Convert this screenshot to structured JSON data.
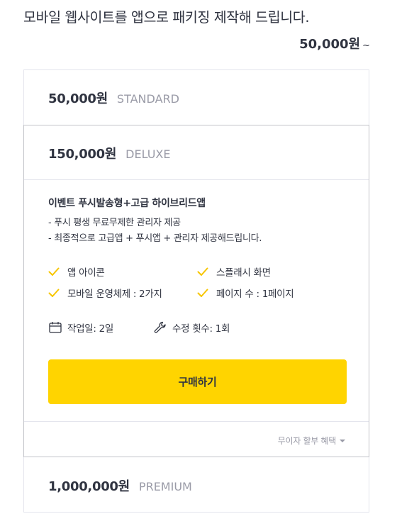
{
  "service": {
    "title": "모바일 웹사이트를 앱으로 패키징 제작해 드립니다.",
    "price_range": "50,000원",
    "price_range_suffix": "~"
  },
  "packages": {
    "standard": {
      "price": "50,000원",
      "tier": "STANDARD"
    },
    "deluxe": {
      "price": "150,000원",
      "tier": "DELUXE",
      "description": {
        "title": "이벤트 푸시발송형+고급 하이브리드앱",
        "lines": [
          "- 푸시 평생 무료무제한 관리자 제공",
          "- 최종적으로 고급앱 + 푸시앱 + 관리자 제공해드립니다."
        ]
      },
      "features": [
        {
          "label": "앱 아이콘",
          "icon": "check-icon"
        },
        {
          "label": "스플래시 화면",
          "icon": "check-icon"
        },
        {
          "label": "모바일 운영체제 : 2가지",
          "icon": "check-icon"
        },
        {
          "label": "페이지 수 : 1페이지",
          "icon": "check-icon"
        }
      ],
      "work_days": "작업일: 2일",
      "revisions": "수정 횟수: 1회",
      "buy_label": "구매하기",
      "installment_label": "무이자 할부 혜택"
    },
    "premium": {
      "price": "1,000,000원",
      "tier": "PREMIUM"
    }
  },
  "colors": {
    "accent_yellow": "#ffd400",
    "check_yellow": "#f7c600",
    "text": "#303441",
    "muted": "#9a9ba7"
  }
}
